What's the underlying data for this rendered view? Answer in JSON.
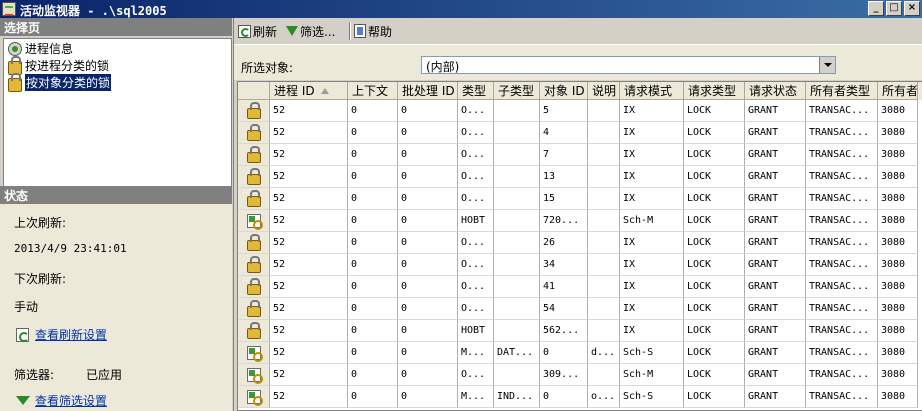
{
  "window": {
    "title": "活动监视器 - .\\sql2005",
    "min": "_",
    "max": "□",
    "close": "×"
  },
  "left": {
    "select_page_header": "选择页",
    "tree_items": [
      "进程信息",
      "按进程分类的锁",
      "按对象分类的锁"
    ],
    "selected_index": 2,
    "status_header": "状态",
    "last_refresh_label": "上次刷新:",
    "last_refresh_value": "2013/4/9 23:41:01",
    "next_refresh_label": "下次刷新:",
    "next_refresh_value": "手动",
    "view_refresh_settings": "查看刷新设置",
    "filter_label": "筛选器:",
    "filter_value": "已应用",
    "view_filter_settings": "查看筛选设置"
  },
  "toolbar": {
    "refresh": "刷新",
    "filter": "筛选...",
    "help": "帮助"
  },
  "selector": {
    "label": "所选对象:",
    "value": "(内部)"
  },
  "table": {
    "columns": [
      "进程 ID",
      "上下文",
      "批处理 ID",
      "类型",
      "子类型",
      "对象 ID",
      "说明",
      "请求模式",
      "请求类型",
      "请求状态",
      "所有者类型",
      "所有者"
    ],
    "rows": [
      {
        "icon": "lock",
        "cells": [
          "52",
          "0",
          "0",
          "O...",
          "",
          "5",
          "",
          "IX",
          "LOCK",
          "GRANT",
          "TRANSAC...",
          "3080"
        ]
      },
      {
        "icon": "lock",
        "cells": [
          "52",
          "0",
          "0",
          "O...",
          "",
          "4",
          "",
          "IX",
          "LOCK",
          "GRANT",
          "TRANSAC...",
          "3080"
        ]
      },
      {
        "icon": "lock",
        "cells": [
          "52",
          "0",
          "0",
          "O...",
          "",
          "7",
          "",
          "IX",
          "LOCK",
          "GRANT",
          "TRANSAC...",
          "3080"
        ]
      },
      {
        "icon": "lock",
        "cells": [
          "52",
          "0",
          "0",
          "O...",
          "",
          "13",
          "",
          "IX",
          "LOCK",
          "GRANT",
          "TRANSAC...",
          "3080"
        ]
      },
      {
        "icon": "lock",
        "cells": [
          "52",
          "0",
          "0",
          "O...",
          "",
          "15",
          "",
          "IX",
          "LOCK",
          "GRANT",
          "TRANSAC...",
          "3080"
        ]
      },
      {
        "icon": "schema",
        "cells": [
          "52",
          "0",
          "0",
          "HOBT",
          "",
          "720...",
          "",
          "Sch-M",
          "LOCK",
          "GRANT",
          "TRANSAC...",
          "3080"
        ]
      },
      {
        "icon": "lock",
        "cells": [
          "52",
          "0",
          "0",
          "O...",
          "",
          "26",
          "",
          "IX",
          "LOCK",
          "GRANT",
          "TRANSAC...",
          "3080"
        ]
      },
      {
        "icon": "lock",
        "cells": [
          "52",
          "0",
          "0",
          "O...",
          "",
          "34",
          "",
          "IX",
          "LOCK",
          "GRANT",
          "TRANSAC...",
          "3080"
        ]
      },
      {
        "icon": "lock",
        "cells": [
          "52",
          "0",
          "0",
          "O...",
          "",
          "41",
          "",
          "IX",
          "LOCK",
          "GRANT",
          "TRANSAC...",
          "3080"
        ]
      },
      {
        "icon": "lock",
        "cells": [
          "52",
          "0",
          "0",
          "O...",
          "",
          "54",
          "",
          "IX",
          "LOCK",
          "GRANT",
          "TRANSAC...",
          "3080"
        ]
      },
      {
        "icon": "lock",
        "cells": [
          "52",
          "0",
          "0",
          "HOBT",
          "",
          "562...",
          "",
          "IX",
          "LOCK",
          "GRANT",
          "TRANSAC...",
          "3080"
        ]
      },
      {
        "icon": "schema",
        "cells": [
          "52",
          "0",
          "0",
          "M...",
          "DAT...",
          "0",
          "d...",
          "Sch-S",
          "LOCK",
          "GRANT",
          "TRANSAC...",
          "3080"
        ]
      },
      {
        "icon": "schema",
        "cells": [
          "52",
          "0",
          "0",
          "O...",
          "",
          "309...",
          "",
          "Sch-M",
          "LOCK",
          "GRANT",
          "TRANSAC...",
          "3080"
        ]
      },
      {
        "icon": "schema",
        "cells": [
          "52",
          "0",
          "0",
          "M...",
          "IND...",
          "0",
          "o...",
          "Sch-S",
          "LOCK",
          "GRANT",
          "TRANSAC...",
          "3080"
        ]
      }
    ]
  }
}
